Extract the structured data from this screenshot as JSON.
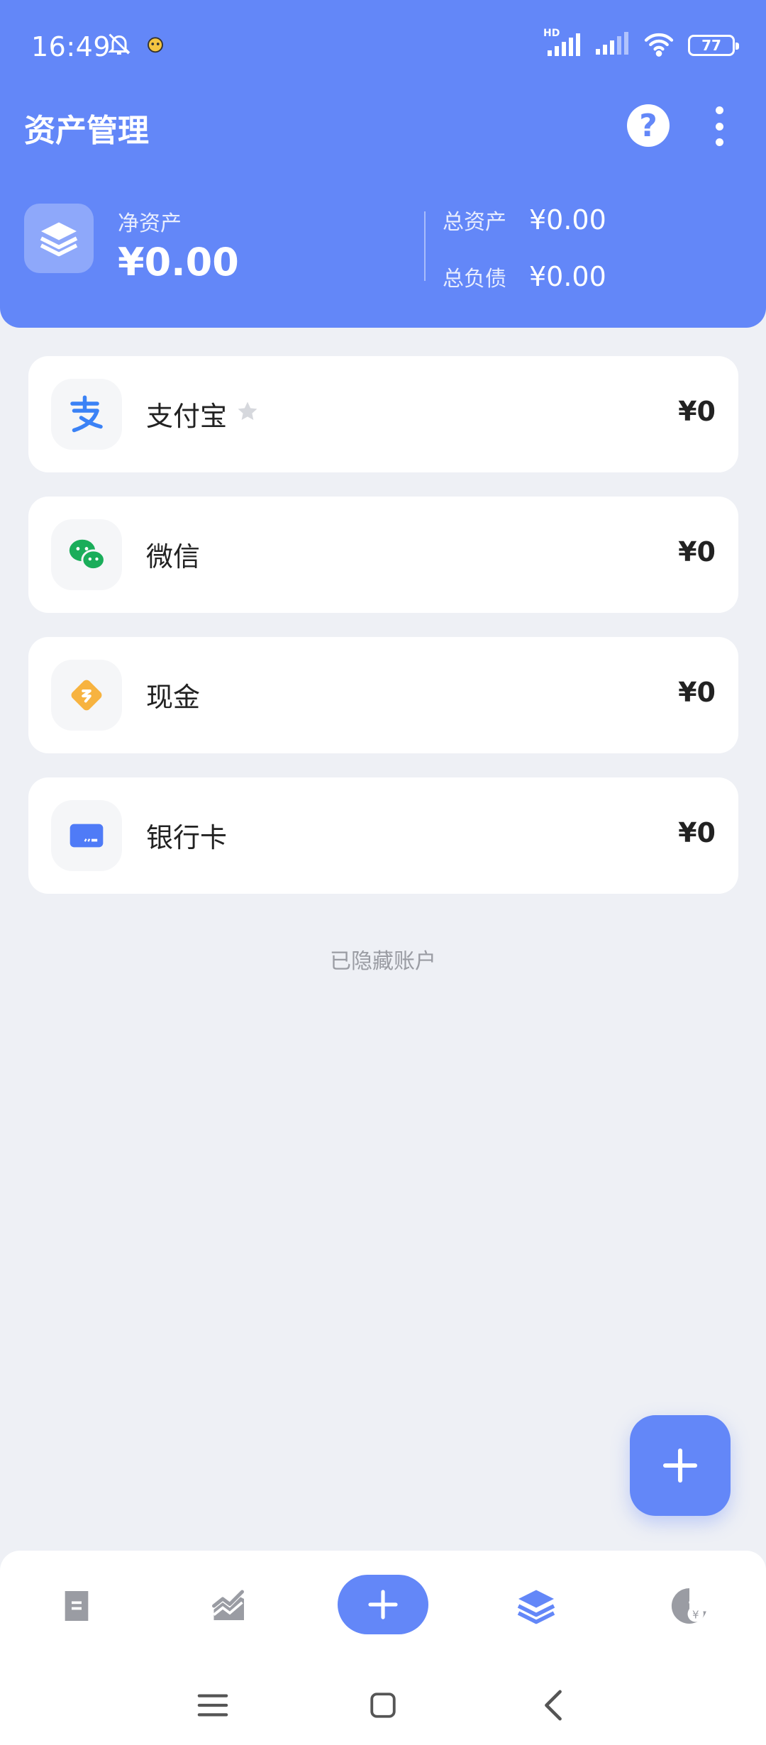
{
  "status_bar": {
    "time": "16:49",
    "battery": "77",
    "network_label": "HD"
  },
  "header": {
    "title": "资产管理",
    "help_symbol": "?",
    "net_assets_label": "净资产",
    "net_assets_value": "¥0.00",
    "total_assets_label": "总资产",
    "total_assets_value": "¥0.00",
    "total_liabilities_label": "总负债",
    "total_liabilities_value": "¥0.00"
  },
  "accounts": [
    {
      "name": "支付宝",
      "balance": "¥0",
      "icon": "alipay-icon",
      "starred": true,
      "icon_color": "#3B82F6"
    },
    {
      "name": "微信",
      "balance": "¥0",
      "icon": "wechat-icon",
      "icon_color": "#1AAD5A"
    },
    {
      "name": "现金",
      "balance": "¥0",
      "icon": "cash-icon",
      "icon_color": "#F7B340"
    },
    {
      "name": "银行卡",
      "balance": "¥0",
      "icon": "bank-card-icon",
      "icon_color": "#4F7BF7"
    }
  ],
  "hidden_accounts_label": "已隐藏账户",
  "bottom_nav": {
    "items": [
      "bill-icon",
      "chart-icon",
      "add-icon",
      "assets-layers-icon",
      "budget-icon"
    ],
    "active": "assets-layers-icon"
  },
  "colors": {
    "accent": "#6387F8",
    "background": "#EEF0F5",
    "text": "#222222",
    "muted": "#9A9CA3"
  }
}
